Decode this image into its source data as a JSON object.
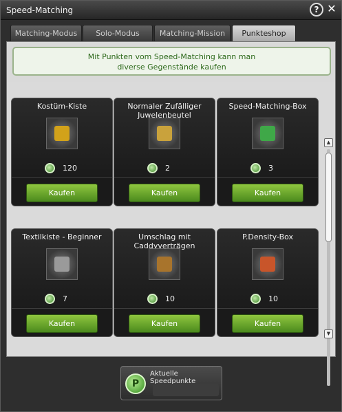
{
  "window": {
    "title": "Speed-Matching"
  },
  "tabs": [
    {
      "label": "Matching-Modus",
      "active": false
    },
    {
      "label": "Solo-Modus",
      "active": false
    },
    {
      "label": "Matching-Mission",
      "active": false
    },
    {
      "label": "Punkteshop",
      "active": true
    }
  ],
  "info": {
    "line1": "Mit Punkten vom Speed-Matching kann man",
    "line2": "diverse Gegenstände kaufen"
  },
  "items": [
    {
      "name": "Kostüm-Kiste",
      "price": "120",
      "buy_label": "Kaufen",
      "icon": "costume-box-icon",
      "icon_color": "#d2a21a"
    },
    {
      "name": "Normaler Zufälliger Juwelenbeutel",
      "price": "2",
      "buy_label": "Kaufen",
      "icon": "jewel-bag-icon",
      "icon_color": "#c9a23c"
    },
    {
      "name": "Speed-Matching-Box",
      "price": "3",
      "buy_label": "Kaufen",
      "icon": "speed-matching-box-icon",
      "icon_color": "#3fa848"
    },
    {
      "name": "Textilkiste - Beginner",
      "price": "7",
      "buy_label": "Kaufen",
      "icon": "textile-box-icon",
      "icon_color": "#9a9a9a"
    },
    {
      "name": "Umschlag mit Caddyverträgen",
      "price": "10",
      "buy_label": "Kaufen",
      "icon": "caddy-envelope-icon",
      "icon_color": "#a8742c"
    },
    {
      "name": "P.Density-Box",
      "price": "10",
      "buy_label": "Kaufen",
      "icon": "p-density-box-icon",
      "icon_color": "#c8552a"
    }
  ],
  "points": {
    "label": "Aktuelle Speedpunkte",
    "icon_letter": "P"
  }
}
